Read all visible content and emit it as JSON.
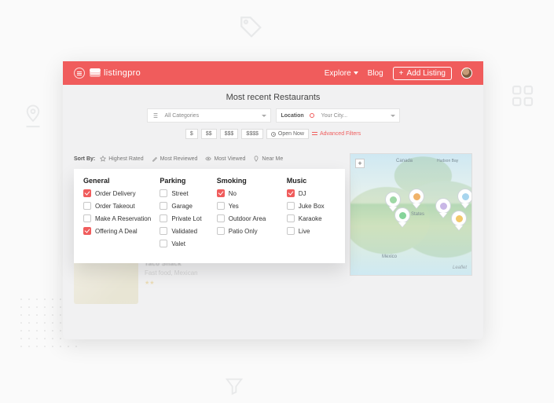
{
  "header": {
    "brand": "listingpro",
    "explore": "Explore",
    "blog": "Blog",
    "add_listing": "Add Listing"
  },
  "page": {
    "title": "Most recent Restaurants",
    "search": {
      "categories_placeholder": "All Categories",
      "location_label": "Location",
      "location_placeholder": "Your City..."
    },
    "price_filters": [
      "$",
      "$$",
      "$$$",
      "$$$$"
    ],
    "open_now": "Open Now",
    "advanced": "Advanced Filters"
  },
  "sort": {
    "label": "Sort By:",
    "options": [
      "Highest Rated",
      "Most Reviewed",
      "Most Viewed",
      "Near Me"
    ]
  },
  "filters": {
    "groups": [
      {
        "title": "General",
        "items": [
          {
            "label": "Order Delivery",
            "checked": true
          },
          {
            "label": "Order Takeout",
            "checked": false
          },
          {
            "label": "Make A Reservation",
            "checked": false
          },
          {
            "label": "Offering A Deal",
            "checked": true
          }
        ]
      },
      {
        "title": "Parking",
        "items": [
          {
            "label": "Street",
            "checked": false
          },
          {
            "label": "Garage",
            "checked": false
          },
          {
            "label": "Private Lot",
            "checked": false
          },
          {
            "label": "Validated",
            "checked": false
          },
          {
            "label": "Valet",
            "checked": false
          }
        ]
      },
      {
        "title": "Smoking",
        "items": [
          {
            "label": "No",
            "checked": true
          },
          {
            "label": "Yes",
            "checked": false
          },
          {
            "label": "Outdoor Area",
            "checked": false
          },
          {
            "label": "Patio Only",
            "checked": false
          }
        ]
      },
      {
        "title": "Music",
        "items": [
          {
            "label": "DJ",
            "checked": true
          },
          {
            "label": "Juke Box",
            "checked": false
          },
          {
            "label": "Karaoke",
            "checked": false
          },
          {
            "label": "Live",
            "checked": false
          }
        ]
      }
    ]
  },
  "map": {
    "labels": {
      "canada": "Canada",
      "usa": "United States",
      "mexico": "Mexico",
      "hudson": "Hudson Bay"
    },
    "provider": "Leaflet"
  },
  "listing_preview": {
    "name": "Taco Shack",
    "subtitle": "Fast food, Mexican"
  }
}
